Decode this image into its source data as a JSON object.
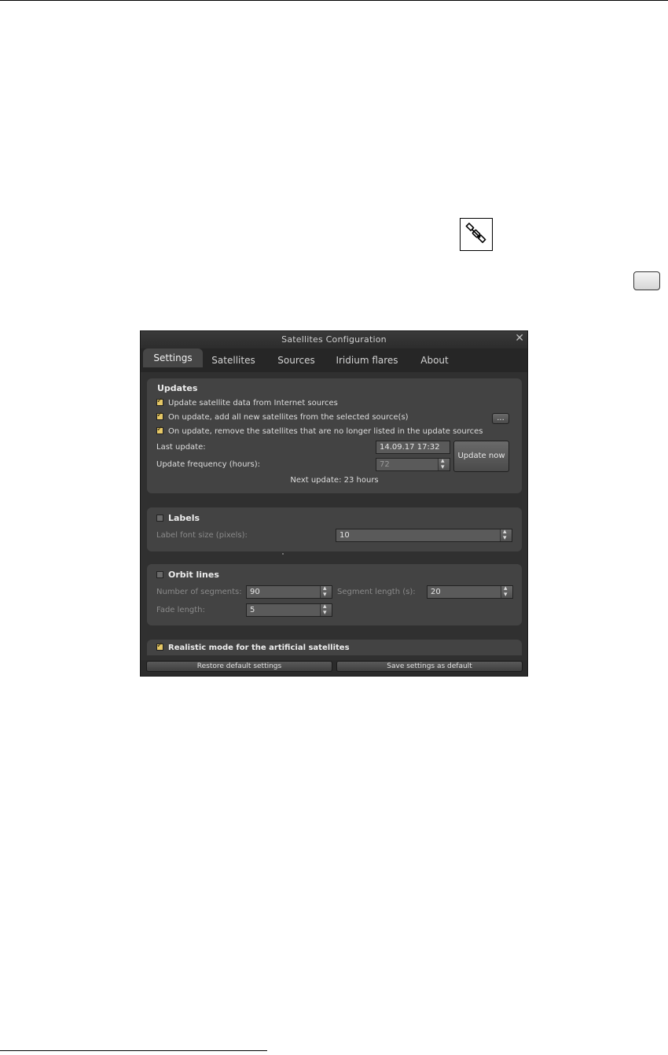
{
  "dialog": {
    "title": "Satellites Configuration",
    "close_glyph": "✕"
  },
  "tabs": [
    {
      "label": "Settings",
      "active": true
    },
    {
      "label": "Satellites"
    },
    {
      "label": "Sources"
    },
    {
      "label": "Iridium flares"
    },
    {
      "label": "About"
    }
  ],
  "updates": {
    "title": "Updates",
    "opt_internet": "Update satellite data from Internet sources",
    "opt_add_new": "On update, add all new satellites from the selected source(s)",
    "opt_remove": "On update, remove the satellites that are no longer listed in the update sources",
    "more_button": "...",
    "last_update_label": "Last update:",
    "last_update_value": "14.09.17 17:32",
    "frequency_label": "Update frequency (hours):",
    "frequency_value": "72",
    "update_now_button": "Update now",
    "next_update": "Next update: 23 hours"
  },
  "labels": {
    "title": "Labels",
    "font_size_label": "Label font size (pixels):",
    "font_size_value": "10"
  },
  "orbit": {
    "title": "Orbit lines",
    "segments_label": "Number of segments:",
    "segments_value": "90",
    "segment_length_label": "Segment length (s):",
    "segment_length_value": "20",
    "fade_label": "Fade length:",
    "fade_value": "5"
  },
  "realistic": {
    "title": "Realistic mode for the artificial satellites"
  },
  "bottom": {
    "restore_button": "Restore default settings",
    "save_button": "Save settings as default"
  },
  "icons": {
    "toolbar_icon": "satellite-icon",
    "key_button": "keyboard-key-icon"
  },
  "colors": {
    "checkbox_on": "#e6c866",
    "dialog_bg": "#2b2b2b",
    "group_bg": "#434343"
  }
}
